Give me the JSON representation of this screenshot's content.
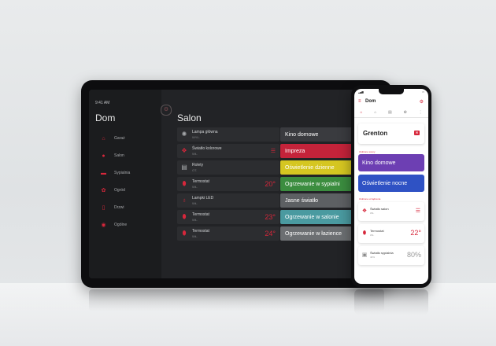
{
  "tablet": {
    "time": "9:41 AM",
    "home_title": "Dom",
    "nav": [
      {
        "label": "Garaż",
        "icon": "garage-icon",
        "glyph": "⌂"
      },
      {
        "label": "Salon",
        "icon": "sofa-icon",
        "glyph": "●"
      },
      {
        "label": "Sypialnia",
        "icon": "bed-icon",
        "glyph": "▬"
      },
      {
        "label": "Ogród",
        "icon": "garden-icon",
        "glyph": "✿"
      },
      {
        "label": "Drzwi",
        "icon": "door-icon",
        "glyph": "▯"
      },
      {
        "label": "Ogólne",
        "icon": "general-icon",
        "glyph": "◉"
      }
    ],
    "room_title": "Salon",
    "devices": [
      {
        "name": "Lampa główna",
        "state": "WYŁ.",
        "value": ""
      },
      {
        "name": "Światło kolorowe",
        "state": "WŁ.",
        "value": ""
      },
      {
        "name": "Rolety",
        "state": "OT.",
        "value": ""
      },
      {
        "name": "Termostat",
        "state": "WŁ.",
        "value": "20°"
      },
      {
        "name": "Lampki LED",
        "state": "WŁ.",
        "value": ""
      },
      {
        "name": "Termostat",
        "state": "WŁ.",
        "value": "23°"
      },
      {
        "name": "Termostat",
        "state": "WŁ.",
        "value": "24°"
      }
    ],
    "scenes": [
      {
        "label": "Kino domowe",
        "color": "#3a3b3f"
      },
      {
        "label": "Impreza",
        "color": "#c4233a"
      },
      {
        "label": "Oświetlenie dzienne",
        "color": "#d5c621"
      },
      {
        "label": "Ogrzewanie w sypialni",
        "color": "#3b8d3f"
      },
      {
        "label": "Jasne światło",
        "color": "#5d6063"
      },
      {
        "label": "Ogrzewanie w salonie",
        "color": "#4a9aa0"
      },
      {
        "label": "Ogrzewanie w łazience",
        "color": "#6c6f72"
      }
    ]
  },
  "phone": {
    "title": "Dom",
    "card_title": "Grenton",
    "scenes_heading": "Ulubione sceny",
    "scenes": [
      {
        "label": "Kino domowe",
        "color": "#6d3fb3"
      },
      {
        "label": "Oświetlenie nocne",
        "color": "#2f52c4"
      }
    ],
    "devices_heading": "Ulubione urządzenia",
    "devices": [
      {
        "name": "Światło salon",
        "state": "WŁ.",
        "value": ""
      },
      {
        "name": "Termostat",
        "state": "WŁ.",
        "value": "22°"
      },
      {
        "name": "Światło sypialnia",
        "state": "40%",
        "value": "80%"
      }
    ]
  },
  "colors": {
    "accent": "#d6273b"
  }
}
